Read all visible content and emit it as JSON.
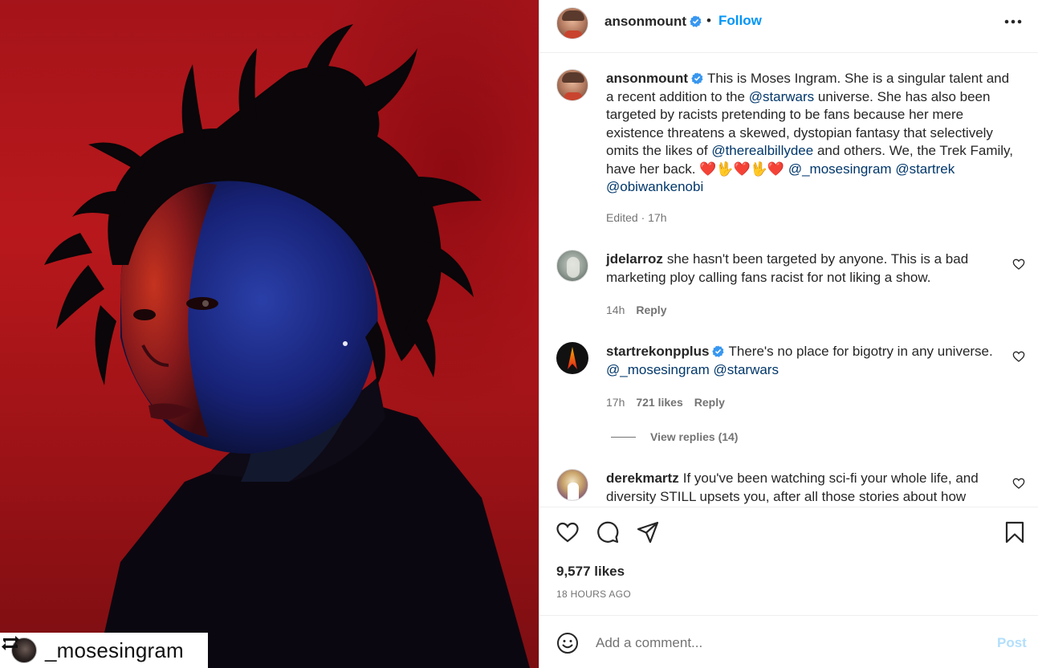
{
  "post": {
    "author": "ansonmount",
    "follow_label": "Follow",
    "dot": "•",
    "caption": {
      "author": "ansonmount",
      "text_1": "This is Moses Ingram. She is a singular talent and a recent addition to the ",
      "mention_1": "@starwars",
      "text_2": " universe. She has also been targeted by racists pretending to be fans because her mere existence threatens a skewed, dystopian fantasy that selectively omits the likes of ",
      "mention_2": "@therealbillydee",
      "text_3": " and others. We, the Trek Family, have her back. ",
      "emojis": "❤️🖖❤️🖖❤️",
      "mention_3": "@_mosesingram",
      "mention_4": "@startrek",
      "mention_5": "@obiwankenobi",
      "edited": "Edited · 17h"
    },
    "likes": "9,577 likes",
    "time_ago": "18 HOURS AGO"
  },
  "comments": [
    {
      "user": "jdelarroz",
      "text": "she hasn't been targeted by anyone. This is a bad marketing ploy calling fans racist for not liking a show.",
      "age": "14h",
      "reply": "Reply"
    },
    {
      "user": "startrekonpplus",
      "text": "There's no place for bigotry in any universe.",
      "mention_1": "@_mosesingram",
      "mention_2": "@starwars",
      "age": "17h",
      "likes": "721 likes",
      "reply": "Reply",
      "view_replies": "View replies (14)"
    },
    {
      "user": "derekmartz",
      "text": "If you've been watching sci-fi your whole life, and diversity STILL upsets you, after all those stories about how"
    }
  ],
  "comment_bar": {
    "placeholder": "Add a comment...",
    "post_label": "Post"
  },
  "photo_tag": {
    "username": "_mosesingram"
  },
  "icons": [
    "verified-icon",
    "more-options-icon",
    "heart-icon",
    "comment-icon",
    "share-icon",
    "bookmark-icon",
    "emoji-icon",
    "repost-icon"
  ],
  "colors": {
    "link": "#0095f6",
    "mention": "#00376b",
    "verified": "#3897f0",
    "post_disabled": "#b2dffc",
    "photo_red": "#b8181c"
  }
}
